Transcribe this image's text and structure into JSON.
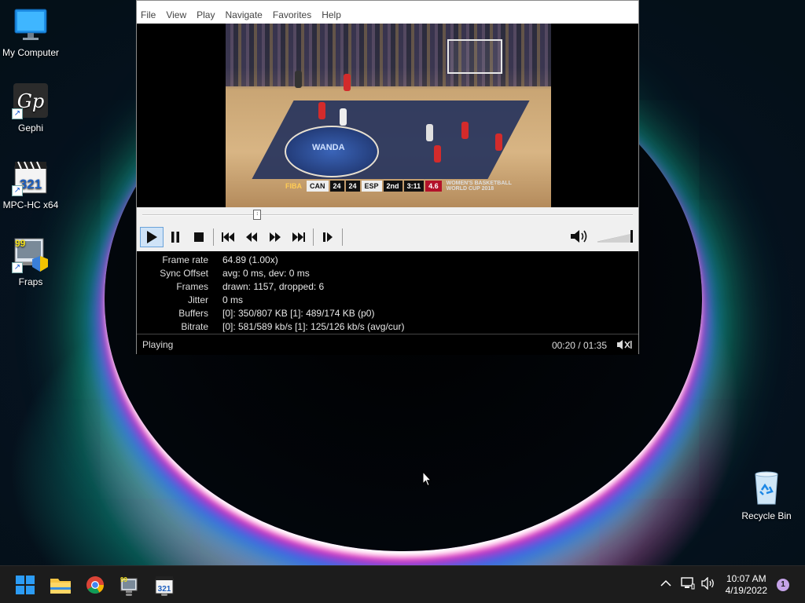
{
  "desktop": {
    "icons": [
      {
        "label": "My Computer",
        "icon": "monitor-icon"
      },
      {
        "label": "Gephi",
        "icon": "gephi-icon"
      },
      {
        "label": "MPC-HC x64",
        "icon": "mpc-hc-icon"
      },
      {
        "label": "Fraps",
        "icon": "fraps-icon"
      }
    ],
    "recycle_bin": {
      "label": "Recycle Bin",
      "icon": "recycle-bin-icon"
    }
  },
  "player": {
    "menu": [
      "File",
      "View",
      "Play",
      "Navigate",
      "Favorites",
      "Help"
    ],
    "video": {
      "court_brand": "WANDA",
      "scorebug": {
        "league": "FIBA",
        "team1": "CAN",
        "score1": "24",
        "score2": "24",
        "team2": "ESP",
        "period": "2nd",
        "clock": "3:11",
        "shot_clock": "4.6",
        "event_line1": "WOMEN'S BASKETBALL",
        "event_line2": "WORLD CUP 2018"
      }
    },
    "seek_position": 0.23,
    "volume_level": 1.0,
    "controls": [
      "play-icon",
      "pause-icon",
      "stop-icon",
      "skip-back-icon",
      "rewind-icon",
      "fast-forward-icon",
      "skip-forward-icon",
      "frame-step-icon"
    ],
    "stats": [
      {
        "label": "Frame rate",
        "value": "64.89 (1.00x)"
      },
      {
        "label": "Sync Offset",
        "value": "avg: 0 ms, dev: 0 ms"
      },
      {
        "label": "Frames",
        "value": "drawn: 1157, dropped: 6"
      },
      {
        "label": "Jitter",
        "value": "0 ms"
      },
      {
        "label": "Buffers",
        "value": "[0]: 350/807 KB [1]: 489/174 KB (p0)"
      },
      {
        "label": "Bitrate",
        "value": "[0]: 581/589 kb/s [1]: 125/126 kb/s (avg/cur)"
      }
    ],
    "status": "Playing",
    "time": "00:20 / 01:35"
  },
  "taskbar": {
    "apps": [
      "windows-start-icon",
      "file-explorer-icon",
      "chrome-icon",
      "fraps-icon",
      "mpc-hc-icon"
    ],
    "clock_time": "10:07 AM",
    "clock_date": "4/19/2022",
    "notification_count": "1"
  },
  "colors": {
    "accent": "#0078d4",
    "taskbar": "#1c1c1c",
    "stats_bg": "#000000"
  }
}
